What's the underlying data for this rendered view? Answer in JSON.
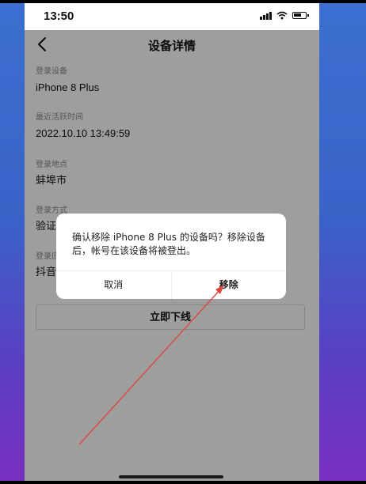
{
  "status_bar": {
    "time": "13:50"
  },
  "nav": {
    "title": "设备详情"
  },
  "fields": [
    {
      "label": "登录设备",
      "value": "iPhone 8 Plus"
    },
    {
      "label": "最近活跃时间",
      "value": "2022.10.10 13:49:59"
    },
    {
      "label": "登录地点",
      "value": "蚌埠市"
    },
    {
      "label": "登录方式",
      "value": "验证码登录"
    },
    {
      "label": "登录应用",
      "value": "抖音"
    }
  ],
  "offline_button": {
    "label": "立即下线"
  },
  "dialog": {
    "message": "确认移除 iPhone 8 Plus 的设备吗？移除设备后，帐号在该设备将被登出。",
    "cancel_label": "取消",
    "confirm_label": "移除"
  },
  "colors": {
    "annotation_arrow": "#e0463a",
    "background_top": "#3b6fd0",
    "background_bottom": "#7a2fc0"
  },
  "icons": {
    "back": "chevron-left-icon",
    "signal": "cellular-signal-icon",
    "wifi": "wifi-icon",
    "battery": "battery-icon"
  }
}
